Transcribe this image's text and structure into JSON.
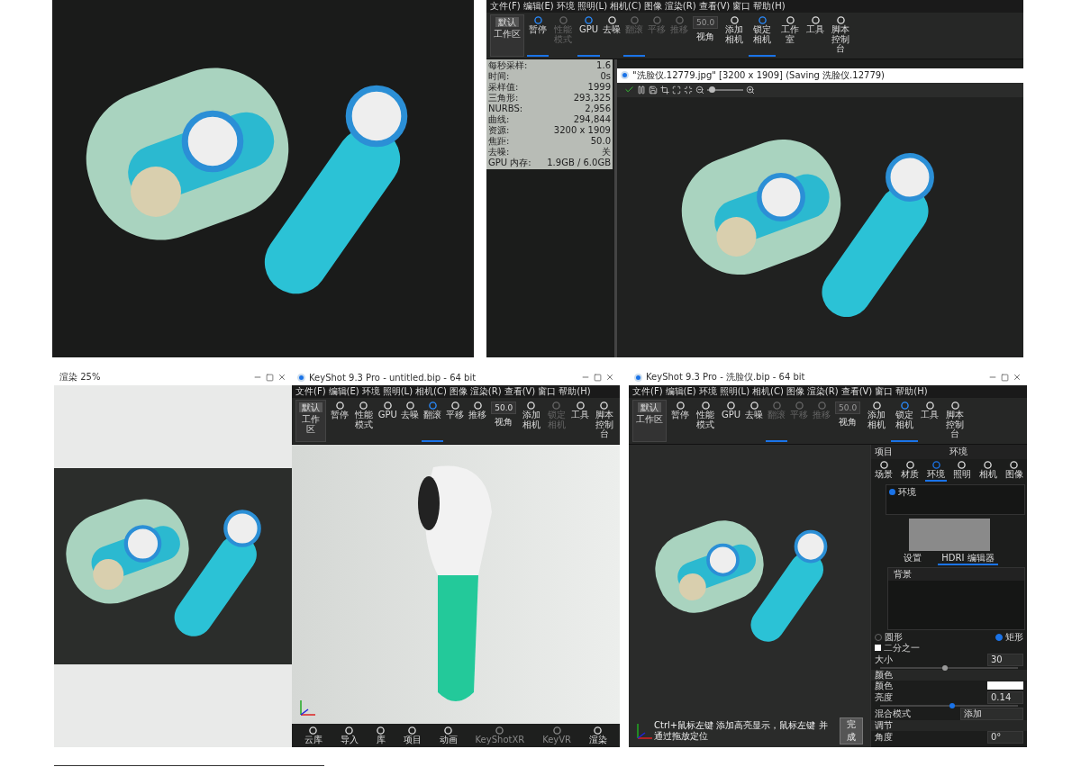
{
  "top_right": {
    "menu": [
      "文件(F)",
      "编辑(E)",
      "环境",
      "照明(L)",
      "相机(C)",
      "图像",
      "渲染(R)",
      "查看(V)",
      "窗口",
      "帮助(H)"
    ],
    "toolbar": [
      {
        "kind": "workspace",
        "value": "默认",
        "label": "工作区"
      },
      {
        "kind": "button",
        "label": "暂停",
        "selected": true,
        "disabled": false
      },
      {
        "kind": "button",
        "label": "性能模式",
        "selected": false,
        "disabled": true
      },
      {
        "kind": "button",
        "label": "GPU",
        "selected": true,
        "disabled": false
      },
      {
        "kind": "button",
        "label": "去噪",
        "selected": false,
        "disabled": false
      },
      {
        "kind": "button",
        "label": "翻滚",
        "selected": true,
        "disabled": true
      },
      {
        "kind": "button",
        "label": "平移",
        "selected": false,
        "disabled": true
      },
      {
        "kind": "button",
        "label": "推移",
        "selected": false,
        "disabled": true
      },
      {
        "kind": "fov",
        "value": "50.0",
        "label": "视角",
        "disabled": true
      },
      {
        "kind": "button",
        "label": "添加相机",
        "selected": false,
        "disabled": false
      },
      {
        "kind": "button",
        "label": "锁定相机",
        "selected": true,
        "disabled": false
      },
      {
        "kind": "button",
        "label": "工作室",
        "selected": false,
        "disabled": false
      },
      {
        "kind": "button",
        "label": "工具",
        "selected": false,
        "disabled": false
      },
      {
        "kind": "button",
        "label": "脚本控制台",
        "selected": false,
        "disabled": false
      }
    ],
    "stats": [
      {
        "label": "每秒采样:",
        "value": "1.6"
      },
      {
        "label": "时间:",
        "value": "0s"
      },
      {
        "label": "采样值:",
        "value": "1999"
      },
      {
        "label": "三角形:",
        "value": "293,325"
      },
      {
        "label": "NURBS:",
        "value": "2,956"
      },
      {
        "label": "曲线:",
        "value": "294,844"
      },
      {
        "label": "资源:",
        "value": "3200 x 1909"
      },
      {
        "label": "焦距:",
        "value": "50.0"
      },
      {
        "label": "去噪:",
        "value": "关"
      },
      {
        "label": "GPU 内存:",
        "value": "1.9GB / 6.0GB"
      }
    ],
    "render_window": {
      "title": "\"洗脸仪.12779.jpg\" [3200 x 1909] (Saving 洗脸仪.12779)",
      "zoom": {
        "level": 0.05
      }
    }
  },
  "render_progress_window": {
    "title": "渲染 25%"
  },
  "bottom_middle": {
    "title": "KeyShot 9.3 Pro - untitled.bip - 64 bit",
    "menu": [
      "文件(F)",
      "编辑(E)",
      "环境",
      "照明(L)",
      "相机(C)",
      "图像",
      "渲染(R)",
      "查看(V)",
      "窗口",
      "帮助(H)"
    ],
    "toolbar": [
      {
        "kind": "workspace",
        "value": "默认",
        "label": "工作区"
      },
      {
        "kind": "button",
        "label": "暂停",
        "selected": false,
        "disabled": false
      },
      {
        "kind": "button",
        "label": "性能模式",
        "selected": false,
        "disabled": false
      },
      {
        "kind": "button",
        "label": "GPU",
        "selected": false,
        "disabled": false
      },
      {
        "kind": "button",
        "label": "去噪",
        "selected": false,
        "disabled": false
      },
      {
        "kind": "button",
        "label": "翻滚",
        "selected": true,
        "disabled": false
      },
      {
        "kind": "button",
        "label": "平移",
        "selected": false,
        "disabled": false
      },
      {
        "kind": "button",
        "label": "推移",
        "selected": false,
        "disabled": false
      },
      {
        "kind": "fov",
        "value": "50.0",
        "label": "视角",
        "disabled": false
      },
      {
        "kind": "button",
        "label": "添加相机",
        "selected": false,
        "disabled": false
      },
      {
        "kind": "button",
        "label": "锁定相机",
        "selected": false,
        "disabled": true
      },
      {
        "kind": "button",
        "label": "工具",
        "selected": false,
        "disabled": false
      },
      {
        "kind": "button",
        "label": "脚本控制台",
        "selected": false,
        "disabled": false
      }
    ],
    "bottom_bar": [
      {
        "label": "云库",
        "disabled": false
      },
      {
        "label": "导入",
        "disabled": false
      },
      {
        "label": "库",
        "disabled": false
      },
      {
        "label": "项目",
        "disabled": false
      },
      {
        "label": "动画",
        "disabled": false
      },
      {
        "label": "KeyShotXR",
        "disabled": true
      },
      {
        "label": "KeyVR",
        "disabled": true
      },
      {
        "label": "渲染",
        "disabled": false
      }
    ]
  },
  "bottom_right": {
    "title": "KeyShot 9.3 Pro - 洗脸仪.bip - 64 bit",
    "menu": [
      "文件(F)",
      "编辑(E)",
      "环境",
      "照明(L)",
      "相机(C)",
      "图像",
      "渲染(R)",
      "查看(V)",
      "窗口",
      "帮助(H)"
    ],
    "toolbar": [
      {
        "kind": "workspace",
        "value": "默认",
        "label": "工作区"
      },
      {
        "kind": "button",
        "label": "暂停",
        "selected": false,
        "disabled": false
      },
      {
        "kind": "button",
        "label": "性能模式",
        "selected": false,
        "disabled": false
      },
      {
        "kind": "button",
        "label": "GPU",
        "selected": false,
        "disabled": false
      },
      {
        "kind": "button",
        "label": "去噪",
        "selected": false,
        "disabled": false
      },
      {
        "kind": "button",
        "label": "翻滚",
        "selected": true,
        "disabled": true
      },
      {
        "kind": "button",
        "label": "平移",
        "selected": false,
        "disabled": true
      },
      {
        "kind": "button",
        "label": "推移",
        "selected": false,
        "disabled": true
      },
      {
        "kind": "fov",
        "value": "50.0",
        "label": "视角",
        "disabled": true
      },
      {
        "kind": "button",
        "label": "添加相机",
        "selected": false,
        "disabled": false
      },
      {
        "kind": "button",
        "label": "锁定相机",
        "selected": true,
        "disabled": false
      },
      {
        "kind": "button",
        "label": "工具",
        "selected": false,
        "disabled": false
      },
      {
        "kind": "button",
        "label": "脚本控制台",
        "selected": false,
        "disabled": false
      }
    ],
    "panel": {
      "header": "项目",
      "title": "环境",
      "tabs": [
        {
          "label": "场景",
          "selected": false
        },
        {
          "label": "材质",
          "selected": false
        },
        {
          "label": "环境",
          "selected": true
        },
        {
          "label": "照明",
          "selected": false
        },
        {
          "label": "相机",
          "selected": false
        },
        {
          "label": "图像",
          "selected": false
        }
      ],
      "environments": [
        "环境"
      ],
      "subtabs": [
        {
          "label": "设置",
          "selected": false
        },
        {
          "label": "HDRI 编辑器",
          "selected": true
        }
      ],
      "background_header": "背景",
      "shapes": [
        {
          "label": "圆形",
          "selected": false
        },
        {
          "label": "矩形",
          "selected": true
        }
      ],
      "half": {
        "label": "二分之一",
        "checked": false
      },
      "size": {
        "label": "大小",
        "value": "30",
        "level": 0.45
      },
      "color_section": "颜色",
      "color": {
        "label": "颜色",
        "color": "#ffffff"
      },
      "brightness": {
        "label": "亮度",
        "value": "0.14",
        "level": 0.5
      },
      "blend": {
        "label": "混合模式",
        "value": "添加"
      },
      "adjust_section": "调节",
      "angle": {
        "label": "角度",
        "value": "0°"
      }
    },
    "hint": {
      "text": "Ctrl+鼠标左键 添加高亮显示，鼠标左键 并通过拖放定位",
      "button": "完成"
    }
  }
}
